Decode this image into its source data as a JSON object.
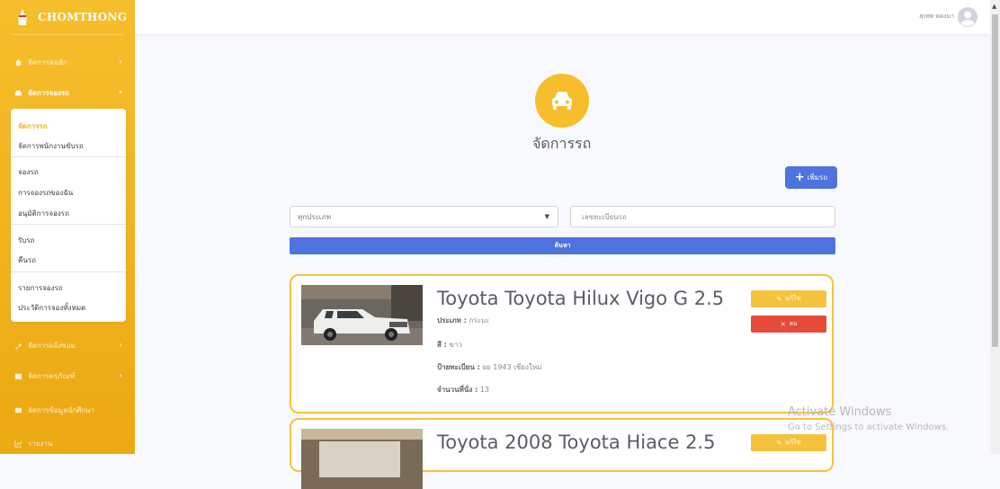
{
  "brand": {
    "name": "CHOMTHONG"
  },
  "sidebar": {
    "items": [
      {
        "label": "จัดการหอพัก",
        "icon": "home-icon",
        "has_arrow": true
      },
      {
        "label": "จัดการจองรถ",
        "icon": "car-icon",
        "has_arrow": true,
        "active": true
      },
      {
        "label": "จัดการแจ้งซ่อม",
        "icon": "wrench-icon",
        "has_arrow": true
      },
      {
        "label": "จัดการครุภัณฑ์",
        "icon": "box-icon",
        "has_arrow": true
      },
      {
        "label": "จัดการข้อมูลนักศึกษา",
        "icon": "id-card-icon",
        "has_arrow": false
      },
      {
        "label": "รายงาน",
        "icon": "chart-icon",
        "has_arrow": false
      }
    ],
    "submenu": [
      {
        "label": "จัดการรถ",
        "active": true
      },
      {
        "label": "จัดการพนักงานขับรถ"
      },
      {
        "label": "จองรถ"
      },
      {
        "label": "การจองรถของฉัน"
      },
      {
        "label": "อนุมัติการจองรถ"
      },
      {
        "label": "รับรถ"
      },
      {
        "label": "คืนรถ"
      },
      {
        "label": "รายการจองรถ"
      },
      {
        "label": "ประวัติการจองทั้งหมด"
      }
    ]
  },
  "topbar": {
    "user_name": "สุเทพ ทองมา"
  },
  "main": {
    "title": "จัดการรถ",
    "add_button": "เพิ่มรถ",
    "type_select": "ทุกประเภท",
    "plate_placeholder": "เลขทะเบียนรถ",
    "search_button": "ค้นหา"
  },
  "cars": [
    {
      "title": "Toyota Toyota Hilux Vigo G 2.5",
      "type_label": "ประเภท :",
      "type_value": "กระบะ",
      "color_label": "สี :",
      "color_value": "ขาว",
      "plate_label": "ป้ายทะเบียน :",
      "plate_value": "ผย 1943 เชียงใหม่",
      "seats_label": "จำนวนที่นั่ง :",
      "seats_value": "13",
      "edit_label": "แก้ไข",
      "delete_label": "ลบ"
    },
    {
      "title": "Toyota 2008 Toyota Hiace 2.5",
      "edit_label": "แก้ไข"
    }
  ],
  "watermark": {
    "line1": "Activate Windows",
    "line2": "Go to Settings to activate Windows."
  },
  "colors": {
    "primary": "#4e73df",
    "warning": "#f6c23e",
    "danger": "#e74a3b",
    "sidebar": "#f1b21d"
  }
}
